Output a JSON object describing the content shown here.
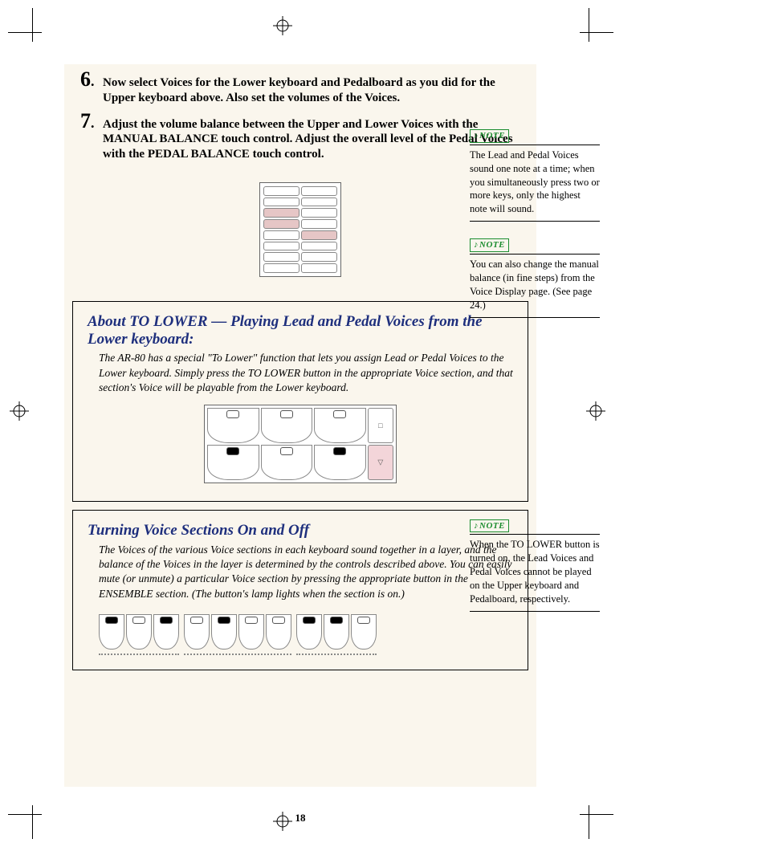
{
  "steps": [
    {
      "num": "6",
      "text": "Now select Voices for the Lower keyboard and Pedalboard as you did for the Upper keyboard above.  Also set the volumes of the Voices."
    },
    {
      "num": "7",
      "text": "Adjust the volume balance between the Upper and Lower Voices with the MANUAL BALANCE touch control.  Adjust the overall level of the Pedal Voices with the PEDAL BALANCE touch control."
    }
  ],
  "boxes": {
    "about": {
      "title": "About TO LOWER — Playing Lead and Pedal Voices from the Lower keyboard:",
      "body": "The AR-80 has a special \"To Lower\" function that lets you assign Lead or Pedal Voices to the Lower keyboard.  Simply press the TO LOWER button in the appropriate Voice section, and that section's Voice will be playable from the Lower keyboard."
    },
    "turning": {
      "title": "Turning Voice Sections On and Off",
      "body": "The Voices of the various Voice sections in each keyboard sound together in a layer, and the balance of the Voices in the layer is determined by the controls described above.  You can easily mute (or unmute) a particular Voice section by pressing the appropriate button in the ENSEMBLE section.  (The button's lamp lights when the section is on.)"
    }
  },
  "notes": {
    "label": "NOTE",
    "n1": "The Lead and Pedal Voices sound one note at a time; when you simultaneously press two or more keys, only the highest note will sound.",
    "n2": "You can also change the manual balance (in fine steps) from the Voice Display page. (See page 24.)",
    "n3": "When the TO LOWER button is turned on, the Lead Voices and Pedal Voices cannot be played on the Upper keyboard and Pedalboard, respectively."
  },
  "page_number": "18"
}
